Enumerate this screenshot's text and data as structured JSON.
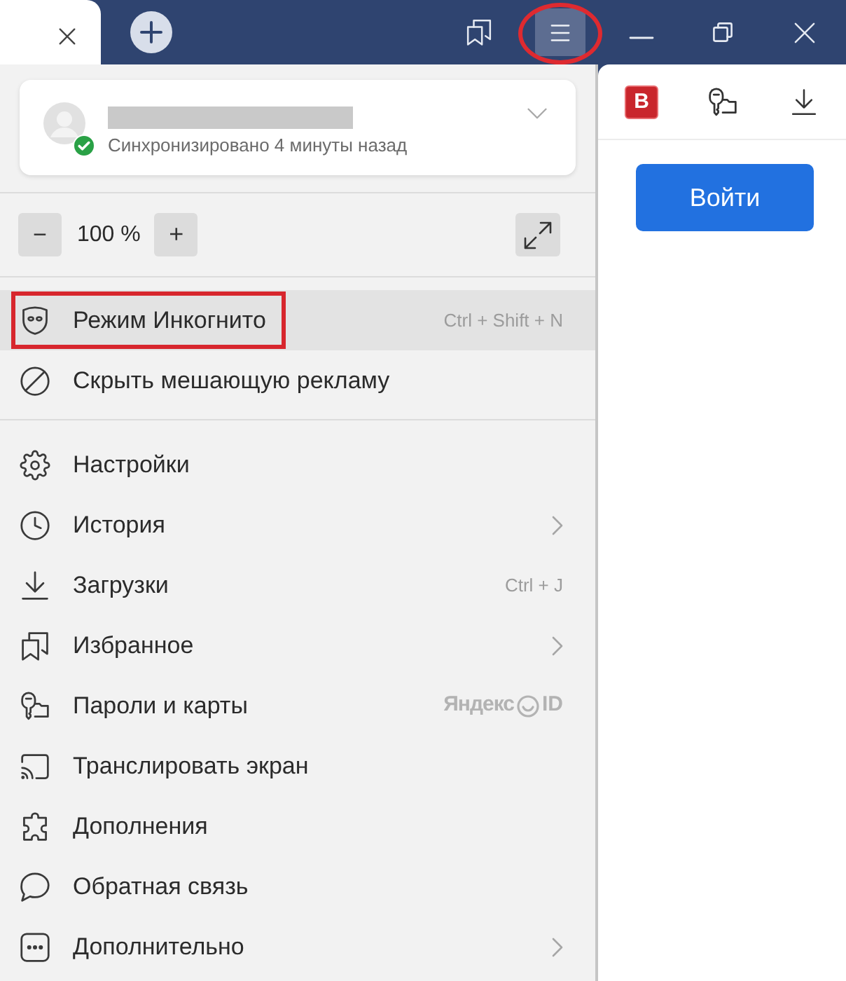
{
  "window": {
    "tabs": [
      {
        "selected": true
      }
    ],
    "menu_button": {
      "pressed": true,
      "annotated": true
    }
  },
  "account": {
    "sync_status": "Синхронизировано 4 минуты назад",
    "synced": true
  },
  "zoom": {
    "decrease": "−",
    "value": "100 %",
    "increase": "+"
  },
  "menu": {
    "sections": [
      {
        "items": [
          {
            "label": "Режим Инкогнито",
            "selected": true,
            "annotated": true,
            "trailing": {
              "kind": "shortcut",
              "text": "Ctrl + Shift + N"
            }
          },
          {
            "label": "Скрыть мешающую рекламу",
            "selected": false,
            "annotated": false
          }
        ]
      },
      {
        "items": [
          {
            "label": "Настройки",
            "selected": false,
            "annotated": false
          },
          {
            "label": "История",
            "selected": false,
            "annotated": false,
            "trailing": {
              "kind": "submenu"
            }
          },
          {
            "label": "Загрузки",
            "selected": false,
            "annotated": false,
            "trailing": {
              "kind": "shortcut",
              "text": "Ctrl + J"
            }
          },
          {
            "label": "Избранное",
            "selected": false,
            "annotated": false,
            "trailing": {
              "kind": "submenu"
            }
          },
          {
            "label": "Пароли и карты",
            "selected": false,
            "annotated": false,
            "trailing": {
              "kind": "account_badge",
              "service": "Яндекс",
              "suffix": "ID"
            }
          },
          {
            "label": "Транслировать экран",
            "selected": false,
            "annotated": false
          },
          {
            "label": "Дополнения",
            "selected": false,
            "annotated": false
          },
          {
            "label": "Обратная связь",
            "selected": false,
            "annotated": false
          },
          {
            "label": "Дополнительно",
            "selected": false,
            "annotated": false,
            "trailing": {
              "kind": "submenu"
            }
          }
        ]
      }
    ]
  },
  "side_panel": {
    "extension_label": "B",
    "login_button": "Войти"
  }
}
